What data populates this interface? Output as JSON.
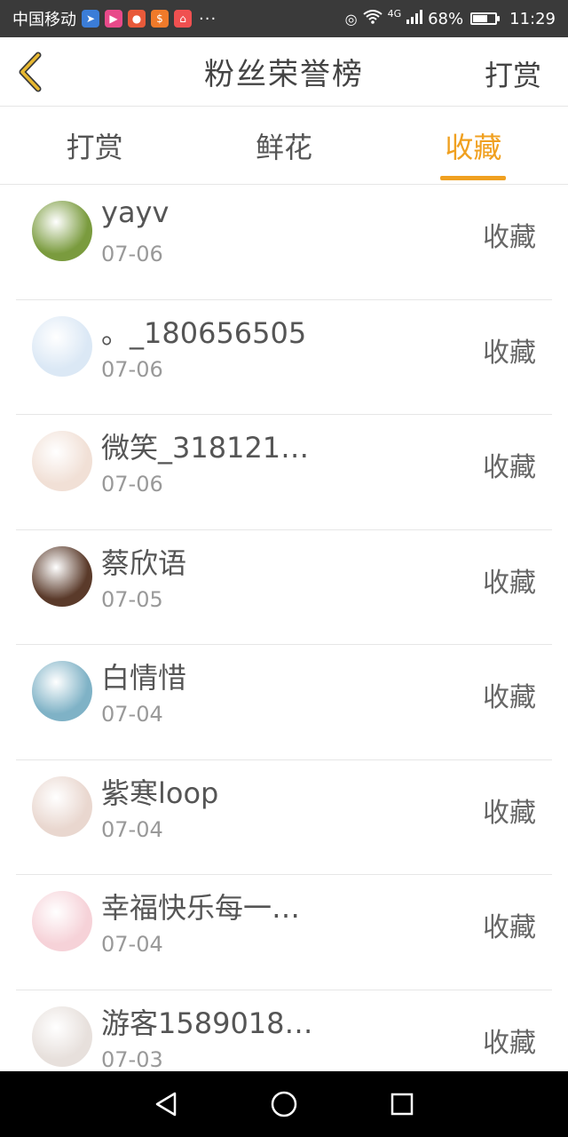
{
  "status_bar": {
    "carrier": "中国移动",
    "more": "···",
    "network": "4G",
    "battery_percent": "68%",
    "battery_level": 0.68,
    "time": "11:29"
  },
  "header": {
    "title": "粉丝荣誉榜",
    "action_label": "打赏",
    "back_icon": "chevron-left-icon"
  },
  "tabs": [
    {
      "label": "打赏",
      "active": false
    },
    {
      "label": "鲜花",
      "active": false
    },
    {
      "label": "收藏",
      "active": true
    }
  ],
  "accent_color": "#f0a020",
  "items": [
    {
      "name": "yayv",
      "date": "07-06",
      "action": "收藏",
      "avatar_color": "#7a9b3e"
    },
    {
      "name": "。_180656505",
      "date": "07-06",
      "action": "收藏",
      "avatar_color": "#dbe8f5"
    },
    {
      "name": "微笑_318121…",
      "date": "07-06",
      "action": "收藏",
      "avatar_color": "#f1e0d6"
    },
    {
      "name": "蔡欣语",
      "date": "07-05",
      "action": "收藏",
      "avatar_color": "#5a3a2a"
    },
    {
      "name": "白情惜",
      "date": "07-04",
      "action": "收藏",
      "avatar_color": "#7fb2c6"
    },
    {
      "name": "紫寒loop",
      "date": "07-04",
      "action": "收藏",
      "avatar_color": "#e9d7cf"
    },
    {
      "name": "幸福快乐每一…",
      "date": "07-04",
      "action": "收藏",
      "avatar_color": "#f6d2d8"
    },
    {
      "name": "游客1589018…",
      "date": "07-03",
      "action": "收藏",
      "avatar_color": "#e7e0dc"
    }
  ]
}
